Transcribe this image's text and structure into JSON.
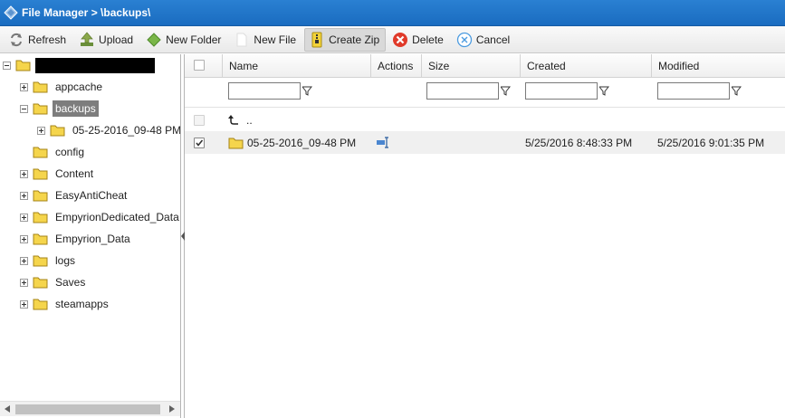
{
  "window": {
    "title": "File Manager > \\backups\\"
  },
  "toolbar": {
    "refresh": "Refresh",
    "upload": "Upload",
    "new_folder": "New Folder",
    "new_file": "New File",
    "create_zip": "Create Zip",
    "delete": "Delete",
    "cancel": "Cancel"
  },
  "tree": {
    "root": {
      "label": "[redacted]",
      "expanded": true
    },
    "items": [
      {
        "label": "appcache",
        "expandable": true
      },
      {
        "label": "backups",
        "expandable": false,
        "expanded": true,
        "selected": true
      },
      {
        "label": "05-25-2016_09-48 PM",
        "expandable": true,
        "child_of": "backups"
      },
      {
        "label": "config",
        "expandable": false
      },
      {
        "label": "Content",
        "expandable": true
      },
      {
        "label": "EasyAntiCheat",
        "expandable": true
      },
      {
        "label": "EmpyrionDedicated_Data",
        "expandable": true
      },
      {
        "label": "Empyrion_Data",
        "expandable": true
      },
      {
        "label": "logs",
        "expandable": true
      },
      {
        "label": "Saves",
        "expandable": true
      },
      {
        "label": "steamapps",
        "expandable": true
      }
    ]
  },
  "grid": {
    "columns": [
      "Name",
      "Actions",
      "Size",
      "Created",
      "Modified"
    ],
    "filters": {
      "name": "",
      "size": "",
      "created": "",
      "modified": ""
    },
    "rows": [
      {
        "name": "..",
        "type": "parent",
        "checked": false,
        "size": "",
        "created": "",
        "modified": ""
      },
      {
        "name": "05-25-2016_09-48 PM",
        "type": "folder",
        "checked": true,
        "size": "",
        "created": "5/25/2016 8:48:33 PM",
        "modified": "5/25/2016 9:01:35 PM"
      }
    ]
  },
  "colors": {
    "titlebar": "#1f74c6",
    "selected_node": "#7d7d7d",
    "folder": "#f5d54c",
    "delete": "#e03a2a",
    "cancel": "#2a7fd0"
  }
}
